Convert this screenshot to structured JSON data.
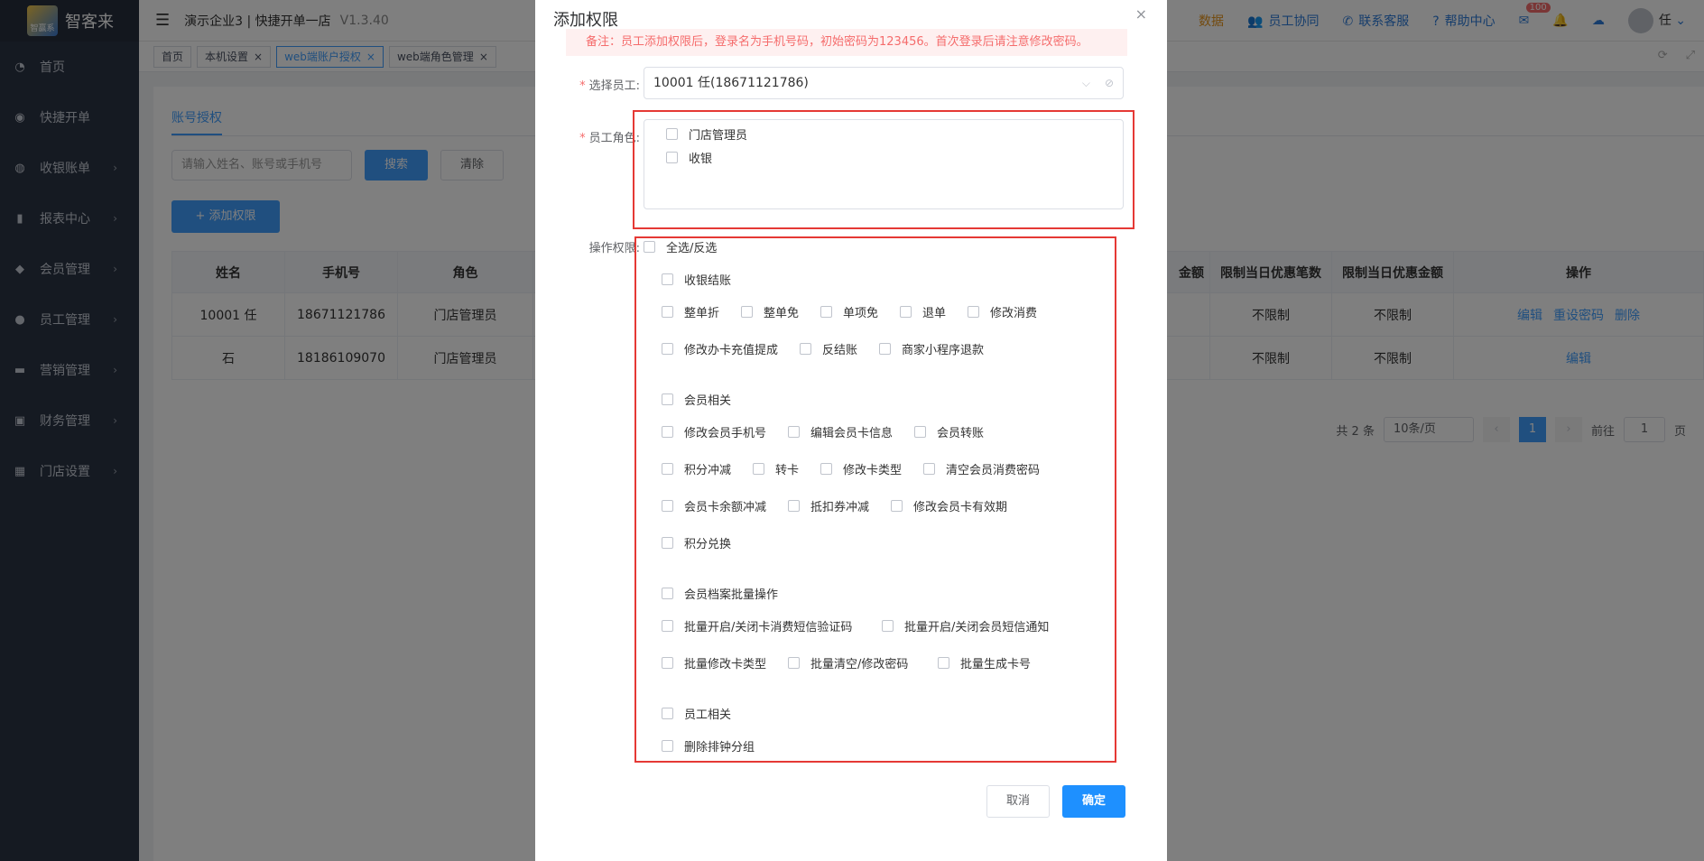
{
  "app": {
    "logo_text": "智客来",
    "logo_small": "智赢系",
    "company": "演示企业3 | 快捷开单一店",
    "version": "V1.3.40"
  },
  "sidebar": {
    "items": [
      {
        "label": "首页",
        "icon": "dashboard-icon",
        "has_arrow": false
      },
      {
        "label": "快捷开单",
        "icon": "bag-icon",
        "has_arrow": false
      },
      {
        "label": "收银账单",
        "icon": "money-bag-icon",
        "has_arrow": true
      },
      {
        "label": "报表中心",
        "icon": "bar-chart-icon",
        "has_arrow": true
      },
      {
        "label": "会员管理",
        "icon": "diamond-icon",
        "has_arrow": true
      },
      {
        "label": "员工管理",
        "icon": "user-icon",
        "has_arrow": true
      },
      {
        "label": "营销管理",
        "icon": "briefcase-icon",
        "has_arrow": true
      },
      {
        "label": "财务管理",
        "icon": "wallet-icon",
        "has_arrow": true
      },
      {
        "label": "门店设置",
        "icon": "grid-icon",
        "has_arrow": true
      }
    ]
  },
  "header": {
    "partial_label": "数据",
    "links": [
      "员工协同",
      "联系客服",
      "帮助中心"
    ],
    "message_count": "100",
    "user": "任"
  },
  "tabs": [
    "首页",
    "本机设置",
    "web端账户授权",
    "web端角色管理"
  ],
  "page": {
    "subtab": "账号授权",
    "search_placeholder": "请输入姓名、账号或手机号",
    "search_btn": "搜索",
    "clear_btn": "清除",
    "add_btn": "+ 添加权限",
    "columns": [
      "姓名",
      "手机号",
      "角色",
      "金额",
      "限制当日优惠笔数",
      "限制当日优惠金额",
      "操作"
    ],
    "rows": [
      {
        "name": "10001 任",
        "phone": "18671121786",
        "role": "门店管理员",
        "count": "不限制",
        "amount": "不限制",
        "actions": [
          "编辑",
          "重设密码",
          "删除"
        ]
      },
      {
        "name": "石",
        "phone": "18186109070",
        "role": "门店管理员",
        "count": "不限制",
        "amount": "不限制",
        "actions": [
          "编辑"
        ]
      }
    ],
    "pager": {
      "total": "共 2 条",
      "size": "10条/页",
      "current": "1",
      "goto_label": "前往",
      "goto_value": "1",
      "page_suffix": "页"
    }
  },
  "dialog": {
    "title": "添加权限",
    "notice": "备注：员工添加权限后，登录名为手机号码，初始密码为123456。首次登录后请注意修改密码。",
    "employee_label": "选择员工:",
    "employee_value": "10001 任(18671121786)",
    "role_label": "员工角色:",
    "roles": [
      "门店管理员",
      "收银"
    ],
    "perm_label": "操作权限:",
    "select_all": "全选/反选",
    "groups": [
      {
        "title": "收银结账",
        "rows": [
          [
            "整单折",
            "整单免",
            "单项免",
            "退单",
            "修改消费"
          ],
          [
            "修改办卡充值提成",
            "反结账",
            "商家小程序退款"
          ]
        ]
      },
      {
        "title": "会员相关",
        "rows": [
          [
            "修改会员手机号",
            "编辑会员卡信息",
            "会员转账"
          ],
          [
            "积分冲减",
            "转卡",
            "修改卡类型",
            "清空会员消费密码"
          ],
          [
            "会员卡余额冲减",
            "抵扣券冲减",
            "修改会员卡有效期"
          ],
          [
            "积分兑换"
          ]
        ]
      },
      {
        "title": "会员档案批量操作",
        "rows": [
          [
            "批量开启/关闭卡消费短信验证码",
            "批量开启/关闭会员短信通知"
          ],
          [
            "批量修改卡类型",
            "批量清空/修改密码",
            "批量生成卡号"
          ]
        ]
      },
      {
        "title": "员工相关",
        "rows": [
          [
            "删除排钟分组"
          ]
        ]
      }
    ],
    "cancel": "取消",
    "confirm": "确定"
  }
}
